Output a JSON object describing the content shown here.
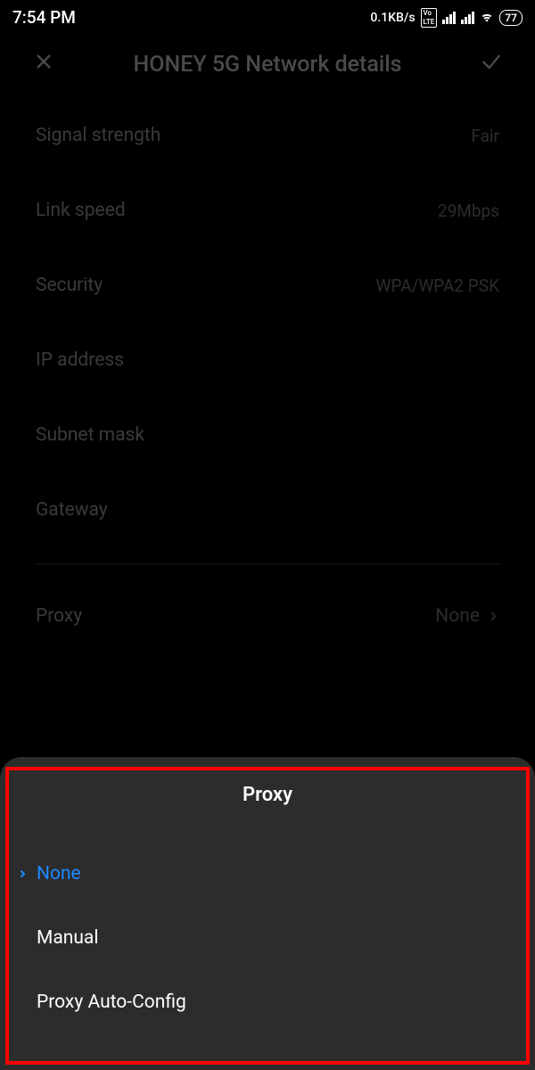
{
  "status_bar": {
    "time": "7:54 PM",
    "data_rate": "0.1KB/s",
    "volte": "Vo LTE",
    "battery": "77"
  },
  "header": {
    "title": "HONEY 5G Network details"
  },
  "details": {
    "signal_strength": {
      "label": "Signal strength",
      "value": "Fair"
    },
    "link_speed": {
      "label": "Link speed",
      "value": "29Mbps"
    },
    "security": {
      "label": "Security",
      "value": "WPA/WPA2 PSK"
    },
    "ip_address": {
      "label": "IP address",
      "value": ""
    },
    "subnet_mask": {
      "label": "Subnet mask",
      "value": ""
    },
    "gateway": {
      "label": "Gateway",
      "value": ""
    }
  },
  "proxy_row": {
    "label": "Proxy",
    "value": "None"
  },
  "sheet": {
    "title": "Proxy",
    "options": {
      "none": "None",
      "manual": "Manual",
      "auto": "Proxy Auto-Config"
    }
  }
}
